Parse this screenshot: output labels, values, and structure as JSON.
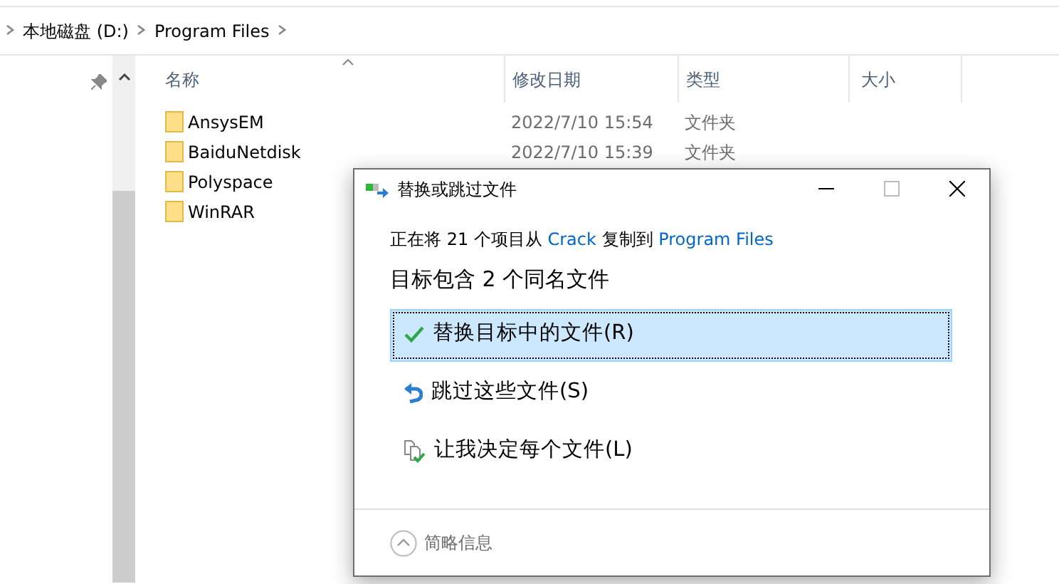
{
  "breadcrumb": [
    "本地磁盘 (D:)",
    "Program Files"
  ],
  "columns": [
    {
      "label": "名称",
      "sorted": true
    },
    {
      "label": "修改日期",
      "sorted": false
    },
    {
      "label": "类型",
      "sorted": false
    },
    {
      "label": "大小",
      "sorted": false
    }
  ],
  "rows": [
    {
      "name": "AnsysEM",
      "modified": "2022/7/10 15:54",
      "type": "文件夹"
    },
    {
      "name": "BaiduNetdisk",
      "modified": "2022/7/10 15:39",
      "type": "文件夹"
    },
    {
      "name": "Polyspace"
    },
    {
      "name": "WinRAR"
    }
  ],
  "dialog": {
    "title": "替换或跳过文件",
    "copy_line": [
      {
        "kind": "text",
        "text": "正在将 21 个项目从"
      },
      {
        "kind": "link",
        "text": "Crack"
      },
      {
        "kind": "text",
        "text": "复制到"
      },
      {
        "kind": "link",
        "text": "Program Files"
      }
    ],
    "heading": "目标包含 2 个同名文件",
    "options": [
      {
        "kind": "replace",
        "label": "替换目标中的文件(R)",
        "selected": true
      },
      {
        "kind": "skip",
        "label": "跳过这些文件(S)",
        "selected": false
      },
      {
        "kind": "decide",
        "label": "让我决定每个文件(L)",
        "selected": false
      }
    ],
    "details_toggle": "简略信息"
  }
}
